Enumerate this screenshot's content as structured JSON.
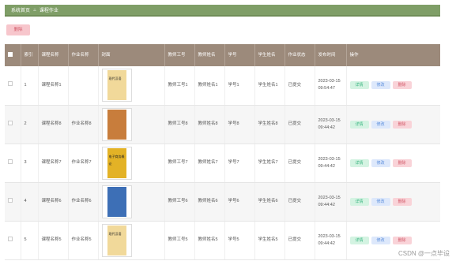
{
  "breadcrumb": {
    "home": "系统首页",
    "separator": "Ξ",
    "current": "课程作业"
  },
  "toolbar": {
    "delete_label": "删除"
  },
  "table": {
    "headers": [
      "",
      "索引",
      "课程名称",
      "作业名称",
      "封面",
      "教师工号",
      "教师姓名",
      "学号",
      "学生姓名",
      "作业状态",
      "发布时间",
      "操作"
    ],
    "rows": [
      {
        "index": "1",
        "course": "课程名称1",
        "homework": "",
        "teacher_id": "教师工号1",
        "teacher_name": "教师姓名1",
        "student_id": "学号1",
        "student_name": "学生姓名1",
        "status": "已提交",
        "time": "2023-03-15 09:54:47",
        "cover_color": "#f1d99a",
        "cover_title": "现代汉语"
      },
      {
        "index": "2",
        "course": "课程名称8",
        "homework": "作业名称8",
        "teacher_id": "教师工号8",
        "teacher_name": "教师姓名8",
        "student_id": "学号8",
        "student_name": "学生姓名8",
        "status": "已提交",
        "time": "2023-03-15 09:44:42",
        "cover_color": "#c87d3c",
        "cover_title": ""
      },
      {
        "index": "3",
        "course": "课程名称7",
        "homework": "作业名称7",
        "teacher_id": "教师工号7",
        "teacher_name": "教师姓名7",
        "student_id": "学号7",
        "student_name": "学生姓名7",
        "status": "已提交",
        "time": "2023-03-15 09:44:42",
        "cover_color": "#e3b226",
        "cover_title": "电子商务概论"
      },
      {
        "index": "4",
        "course": "课程名称6",
        "homework": "作业名称6",
        "teacher_id": "教师工号6",
        "teacher_name": "教师姓名6",
        "student_id": "学号6",
        "student_name": "学生姓名6",
        "status": "已提交",
        "time": "2023-03-15 09:44:42",
        "cover_color": "#3d6fb6",
        "cover_title": ""
      },
      {
        "index": "5",
        "course": "课程名称5",
        "homework": "作业名称5",
        "teacher_id": "教师工号5",
        "teacher_name": "教师姓名5",
        "student_id": "学号5",
        "student_name": "学生姓名5",
        "status": "已提交",
        "time": "2023-03-15 09:44:42",
        "cover_color": "#f1d99a",
        "cover_title": "现代汉语"
      }
    ],
    "actions": {
      "detail": "详情",
      "edit": "修改",
      "delete": "删除"
    }
  },
  "watermark": "CSDN @一点毕设"
}
